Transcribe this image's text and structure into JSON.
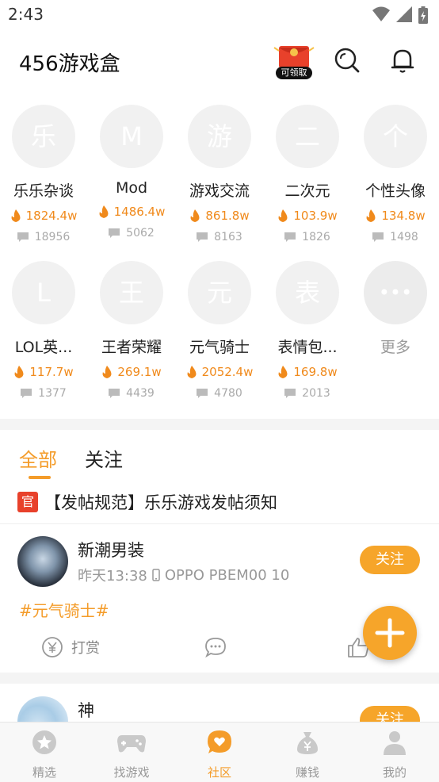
{
  "status": {
    "time": "2:43"
  },
  "header": {
    "title": "456游戏盒",
    "redpack_label": "可领取"
  },
  "categories": [
    {
      "name": "乐乐杂谈",
      "letter": "乐",
      "heat": "1824.4w",
      "count": "18956"
    },
    {
      "name": "Mod",
      "letter": "M",
      "heat": "1486.4w",
      "count": "5062"
    },
    {
      "name": "游戏交流",
      "letter": "游",
      "heat": "861.8w",
      "count": "8163"
    },
    {
      "name": "二次元",
      "letter": "二",
      "heat": "103.9w",
      "count": "1826"
    },
    {
      "name": "个性头像",
      "letter": "个",
      "heat": "134.8w",
      "count": "1498"
    },
    {
      "name": "LOL英...",
      "letter": "L",
      "heat": "117.7w",
      "count": "1377"
    },
    {
      "name": "王者荣耀",
      "letter": "王",
      "heat": "269.1w",
      "count": "4439"
    },
    {
      "name": "元气骑士",
      "letter": "元",
      "heat": "2052.4w",
      "count": "4780"
    },
    {
      "name": "表情包...",
      "letter": "表",
      "heat": "169.8w",
      "count": "2013"
    },
    {
      "name": "更多",
      "letter": "•••",
      "heat": "",
      "count": ""
    }
  ],
  "tabs": {
    "all": "全部",
    "follow": "关注"
  },
  "notice": {
    "badge": "官",
    "text": "【发帖规范】乐乐游戏发帖须知"
  },
  "posts": [
    {
      "name": "新潮男装",
      "time": "昨天13:38",
      "device": "OPPO PBEM00 10",
      "follow": "关注",
      "hashtag": "#元气骑士#",
      "reward": "打赏"
    },
    {
      "name": "神",
      "follow": "关注"
    }
  ],
  "tabbar": [
    {
      "label": "精选",
      "icon": "star-icon"
    },
    {
      "label": "找游戏",
      "icon": "gamepad-icon"
    },
    {
      "label": "社区",
      "icon": "heart-bubble-icon"
    },
    {
      "label": "赚钱",
      "icon": "money-bag-icon"
    },
    {
      "label": "我的",
      "icon": "person-icon"
    }
  ],
  "colors": {
    "accent": "#f49c2a",
    "fab": "#f6a52a",
    "official": "#e8412b",
    "heat": "#f08a1c"
  }
}
